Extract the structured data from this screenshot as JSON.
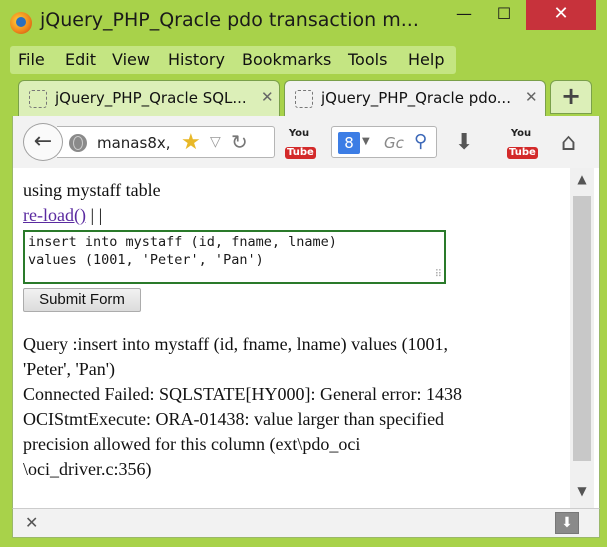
{
  "window": {
    "title": "jQuery_PHP_Qracle pdo transaction m...",
    "minimize": "—",
    "maximize": "☐",
    "close": "✕"
  },
  "menu": {
    "items": [
      "File",
      "Edit",
      "View",
      "History",
      "Bookmarks",
      "Tools",
      "Help"
    ]
  },
  "tabs": [
    {
      "label": "jQuery_PHP_Qracle SQL...",
      "active": false,
      "close": "✕"
    },
    {
      "label": "jQuery_PHP_Qracle pdo...",
      "active": true,
      "close": "✕"
    }
  ],
  "newtab_label": "+",
  "nav": {
    "url": "manas8x,",
    "search_placeholder": "Gc",
    "search_engine_letter": "8",
    "youtube_top": "You",
    "youtube_bottom": "Tube"
  },
  "page": {
    "heading": "using mystaff table",
    "reload_link": "re-load()",
    "reload_separator": "| |",
    "sql_lines": [
      "insert into mystaff (id, fname, lname)",
      "values (1001, 'Peter', 'Pan')"
    ],
    "submit_label": "Submit Form",
    "result_lines": [
      "Query :insert into mystaff (id, fname, lname) values (1001,",
      "'Peter', 'Pan')",
      "Connected Failed: SQLSTATE[HY000]: General error: 1438",
      "OCIStmtExecute: ORA-01438: value larger than specified",
      "precision allowed for this column (ext\\pdo_oci",
      "\\oci_driver.c:356)"
    ]
  },
  "colors": {
    "frame": "#a8d24a",
    "menubar": "#c4e582",
    "close_button": "#c7323b",
    "textarea_border": "#2a7a2a",
    "link": "#5a2aa0"
  }
}
